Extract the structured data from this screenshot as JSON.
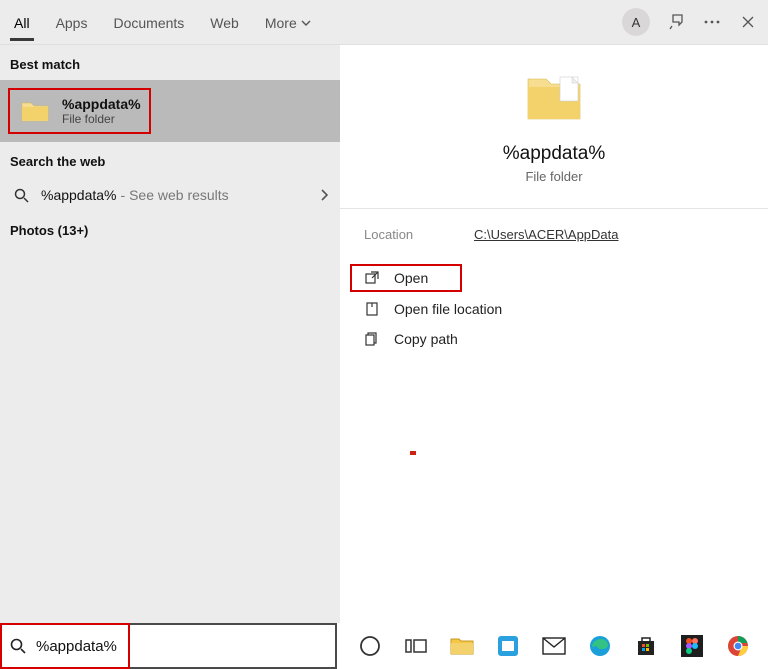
{
  "header": {
    "tabs": [
      "All",
      "Apps",
      "Documents",
      "Web",
      "More"
    ],
    "avatar_letter": "A"
  },
  "left": {
    "best_match_label": "Best match",
    "result_title": "%appdata%",
    "result_type": "File folder",
    "search_web_label": "Search the web",
    "web_query": "%appdata%",
    "web_suffix": "- See web results",
    "photos_label": "Photos (13+)"
  },
  "detail": {
    "title": "%appdata%",
    "type": "File folder",
    "location_label": "Location",
    "location_value": "C:\\Users\\ACER\\AppData",
    "actions": {
      "open": "Open",
      "open_loc": "Open file location",
      "copy_path": "Copy path"
    }
  },
  "search": {
    "value": "%appdata%"
  }
}
